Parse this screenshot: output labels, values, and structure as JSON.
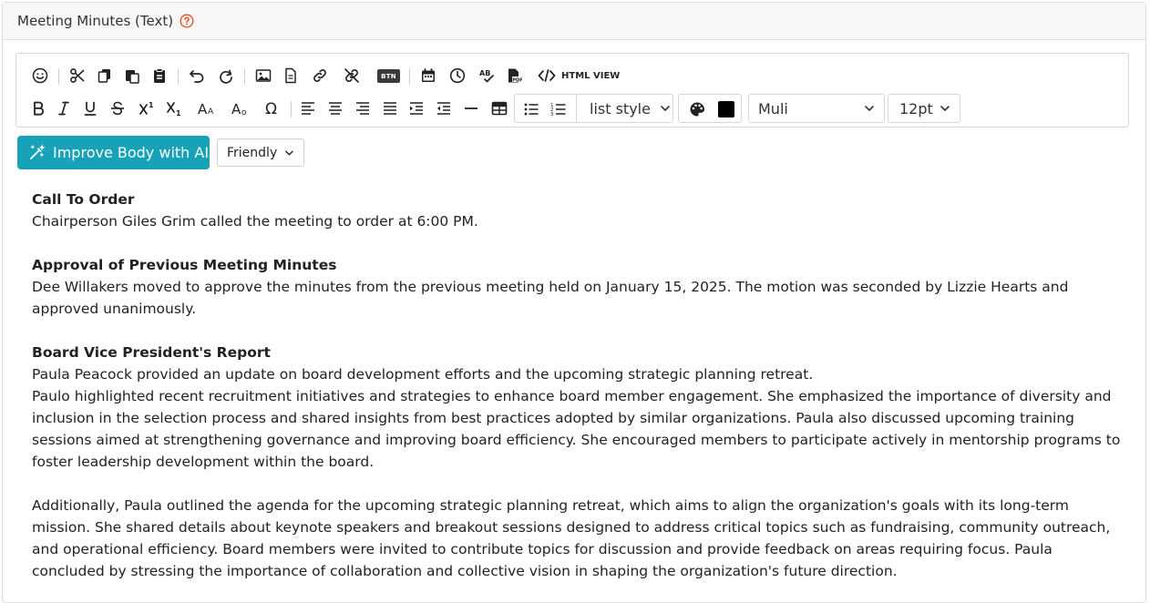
{
  "header": {
    "title": "Meeting Minutes (Text)"
  },
  "toolbar": {
    "btn_chip": "BTN",
    "html_view": "HTML VIEW",
    "list_style": "list style",
    "font_name": "Muli",
    "font_size": "12pt",
    "color_swatch": "#000000"
  },
  "ai": {
    "improve_label": "Improve Body with AI",
    "tone": "Friendly"
  },
  "body": {
    "s1_heading": "Call To Order",
    "s1_text": "Chairperson Giles Grim called the meeting to order at 6:00 PM.",
    "s2_heading": "Approval of Previous Meeting Minutes",
    "s2_text": "Dee Willakers moved to approve the minutes from the previous meeting held on January 15, 2025. The motion was seconded by Lizzie Hearts and approved unanimously.",
    "s3_heading": "Board Vice President's Report",
    "s3_line1": "Paula Peacock provided an update on board development efforts and the upcoming strategic planning retreat.",
    "s3_line2": "Paulo highlighted recent recruitment initiatives and strategies to enhance board member engagement. She emphasized the importance of diversity and inclusion in the selection process and shared insights from best practices adopted by similar organizations. Paula also discussed upcoming training sessions aimed at strengthening governance and improving board efficiency. She encouraged members to participate actively in mentorship programs to foster leadership development within the board.",
    "s4_text": "Additionally, Paula outlined the agenda for the upcoming strategic planning retreat, which aims to align the organization's goals with its long-term mission. She shared details about keynote speakers and breakout sessions designed to address critical topics such as fundraising, community outreach, and operational efficiency. Board members were invited to contribute topics for discussion and provide feedback on areas requiring focus. Paula concluded by stressing the importance of collaboration and collective vision in shaping the organization's future direction."
  },
  "colors": {
    "accent": "#17a2b8",
    "help_icon": "#e8541e"
  }
}
